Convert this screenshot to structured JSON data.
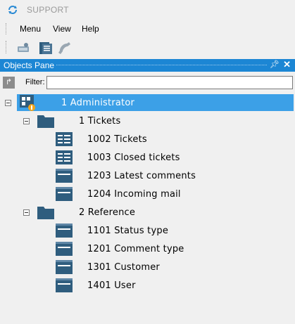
{
  "app": {
    "title": "SUPPORT"
  },
  "menu": {
    "items": [
      "Menu",
      "View",
      "Help"
    ]
  },
  "toolbar": {
    "icons": [
      "connect-icon",
      "object-list-icon",
      "phone-icon"
    ]
  },
  "pane": {
    "title": "Objects Pane",
    "pin": "pin-icon",
    "close": "close-icon"
  },
  "filter": {
    "label": "Filter:",
    "value": "",
    "placeholder": ""
  },
  "tree": {
    "root": {
      "label": "1 Administrator",
      "selected": true
    },
    "groups": [
      {
        "label": "1 Tickets",
        "items": [
          {
            "label": "1002 Tickets",
            "icon": "form-icon"
          },
          {
            "label": "1003 Closed tickets",
            "icon": "form-icon"
          },
          {
            "label": "1203 Latest comments",
            "icon": "table-icon"
          },
          {
            "label": "1204 Incoming mail",
            "icon": "table-icon"
          }
        ]
      },
      {
        "label": "2 Reference",
        "items": [
          {
            "label": "1101 Status type",
            "icon": "table-icon"
          },
          {
            "label": "1201 Comment type",
            "icon": "table-icon"
          },
          {
            "label": "1301 Customer",
            "icon": "table-icon"
          },
          {
            "label": "1401 User",
            "icon": "table-icon"
          }
        ]
      }
    ]
  },
  "colors": {
    "header": "#1c86d4",
    "selection": "#3ca0e7",
    "icon": "#2f5d7e"
  }
}
